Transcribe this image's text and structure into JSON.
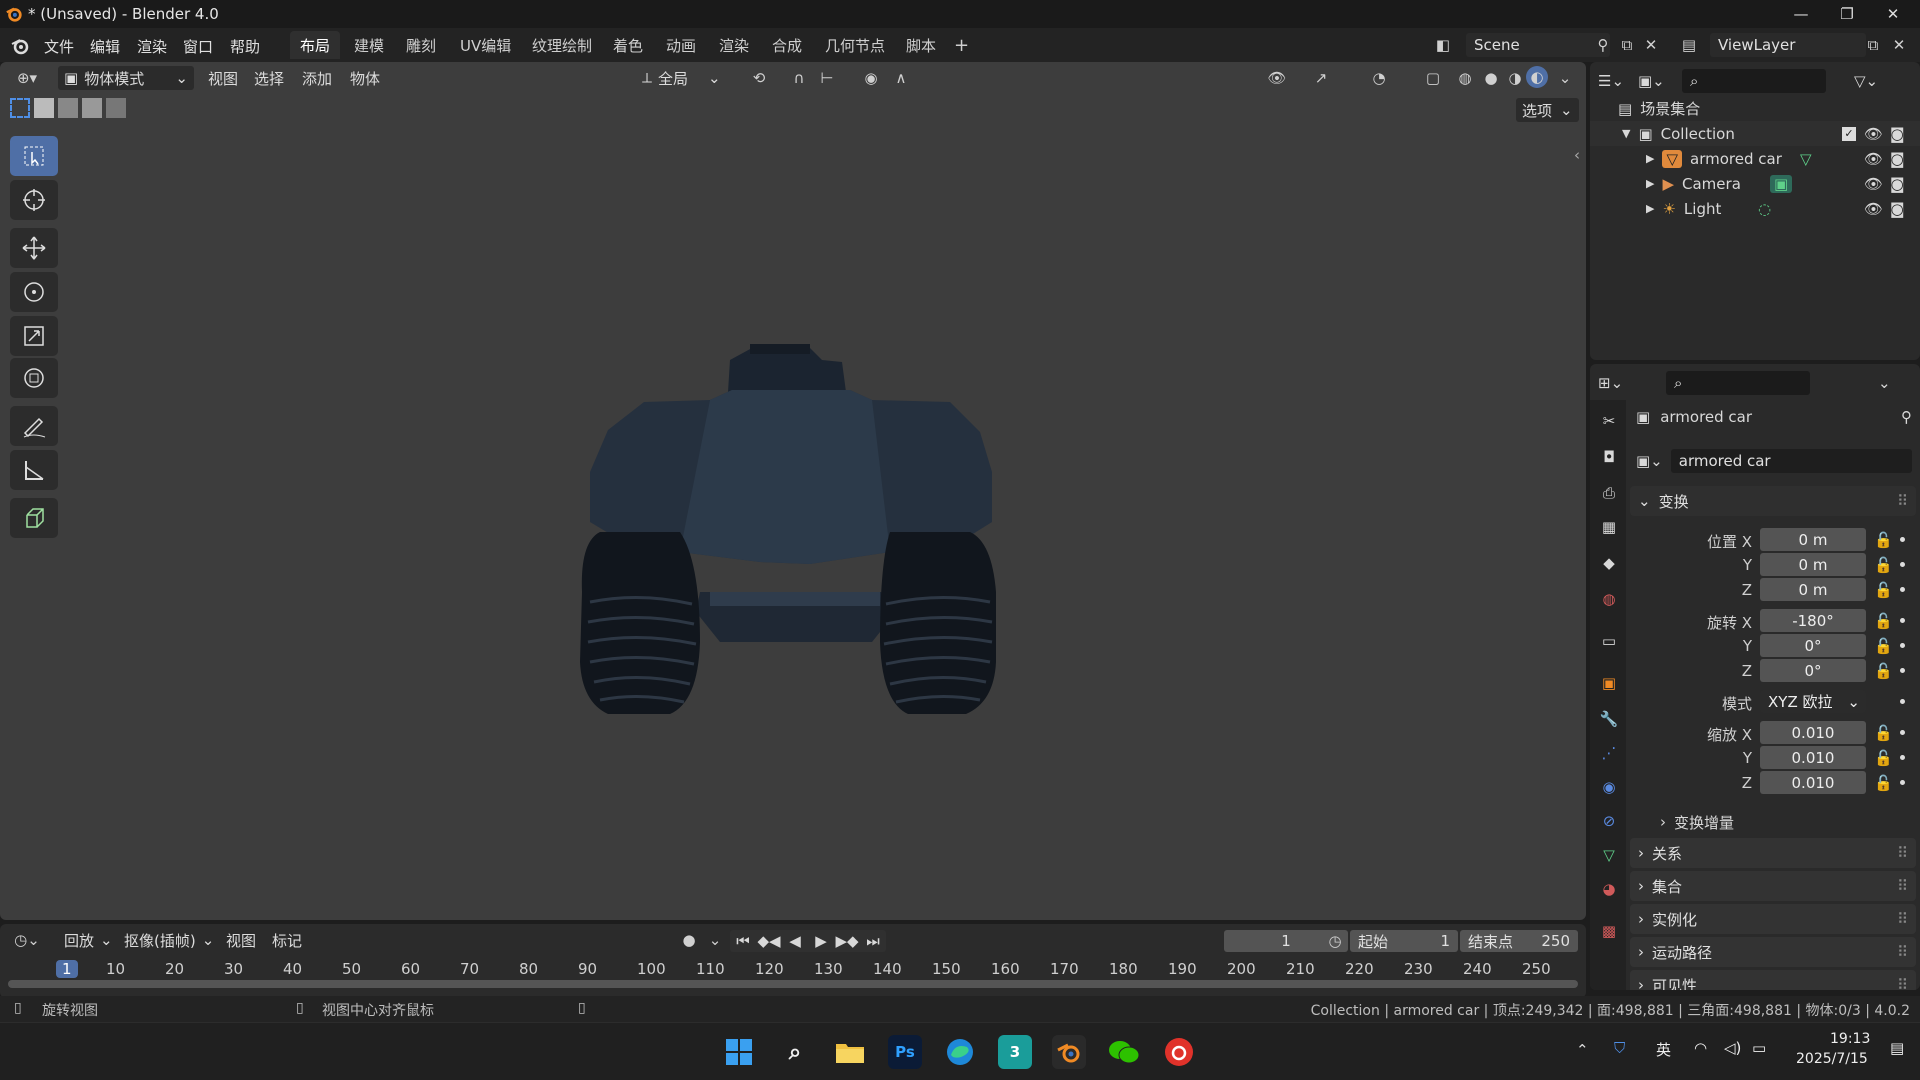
{
  "window": {
    "title": "* (Unsaved) - Blender 4.0"
  },
  "menu": {
    "items": [
      "文件",
      "编辑",
      "渲染",
      "窗口",
      "帮助"
    ],
    "workspaces": [
      "布局",
      "建模",
      "雕刻",
      "UV编辑",
      "纹理绘制",
      "着色",
      "动画",
      "渲染",
      "合成",
      "几何节点",
      "脚本"
    ],
    "active_workspace": "布局",
    "add_tab": "+",
    "scene": "Scene",
    "view_layer": "ViewLayer"
  },
  "viewport": {
    "mode": "物体模式",
    "menus": [
      "视图",
      "选择",
      "添加",
      "物体"
    ],
    "transform_orientation": "全局",
    "options_label": "选项"
  },
  "outliner": {
    "root": "场景集合",
    "collection": "Collection",
    "objects": [
      {
        "name": "armored car",
        "color": "#f0a050"
      },
      {
        "name": "Camera",
        "color": "#e09050"
      },
      {
        "name": "Light",
        "color": "#e0a040"
      }
    ]
  },
  "properties": {
    "object_name": "armored car",
    "data_name": "armored car",
    "transform_section": "变换",
    "location": {
      "label": "位置 X",
      "x": "0 m",
      "y": "0 m",
      "z": "0 m"
    },
    "rotation": {
      "label": "旋转 X",
      "x": "-180°",
      "y": "0°",
      "z": "0°"
    },
    "mode": {
      "label": "模式",
      "value": "XYZ 欧拉"
    },
    "scale": {
      "label": "缩放 X",
      "x": "0.010",
      "y": "0.010",
      "z": "0.010"
    },
    "axis_y": "Y",
    "axis_z": "Z",
    "delta_transform": "变换增量",
    "sections": [
      "关系",
      "集合",
      "实例化",
      "运动路径",
      "可见性"
    ]
  },
  "timeline": {
    "playback": "回放",
    "keying": "抠像(插帧)",
    "view": "视图",
    "marker": "标记",
    "current_frame": "1",
    "start_label": "起始",
    "start": "1",
    "end_label": "结束点",
    "end": "250",
    "ticks": [
      "1",
      "10",
      "20",
      "30",
      "40",
      "50",
      "60",
      "70",
      "80",
      "90",
      "100",
      "110",
      "120",
      "130",
      "140",
      "150",
      "160",
      "170",
      "180",
      "190",
      "200",
      "210",
      "220",
      "230",
      "240",
      "250"
    ]
  },
  "statusbar": {
    "left1": "旋转视图",
    "left2": "视图中心对齐鼠标",
    "stats": "Collection | armored car | 顶点:249,342 | 面:498,881 | 三角面:498,881 | 物体:0/3 | 4.0.2"
  },
  "taskbar": {
    "ime": "英",
    "time": "19:13",
    "date": "2025/7/15",
    "ps_label": "Ps",
    "max_label": "3"
  },
  "colors": {
    "accent": "#4f6fa6",
    "bg": "#3d3d3d"
  }
}
